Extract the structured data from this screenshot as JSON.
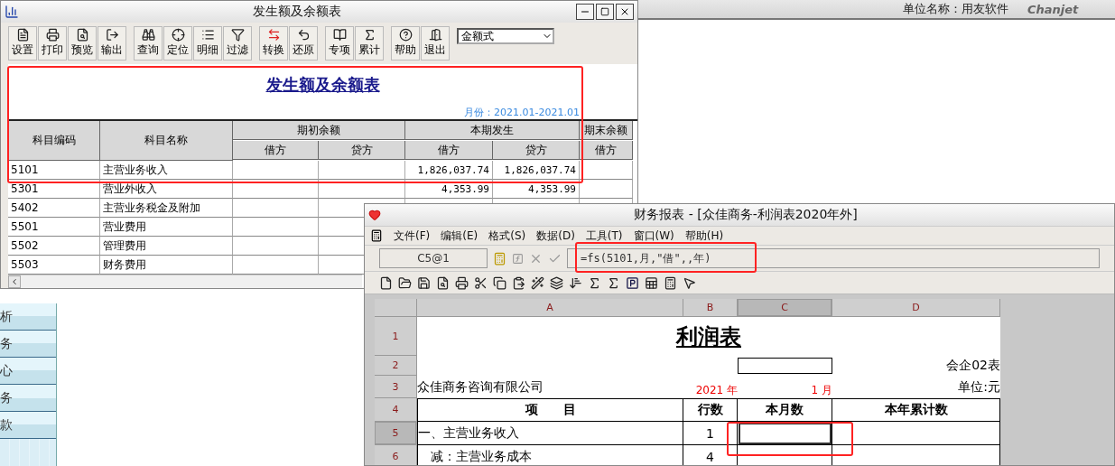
{
  "app_header": {
    "company_label": "单位名称：用友软件",
    "logo_text": "Chanjet"
  },
  "sidebar": {
    "items": [
      {
        "label": "析"
      },
      {
        "label": "务"
      },
      {
        "label": "心"
      },
      {
        "label": "务"
      },
      {
        "label": "款"
      }
    ]
  },
  "balance_window": {
    "title": "发生额及余额表",
    "toolbar": [
      [
        {
          "label": "设置"
        },
        {
          "label": "打印"
        },
        {
          "label": "预览"
        },
        {
          "label": "输出"
        }
      ],
      [
        {
          "label": "查询"
        },
        {
          "label": "定位"
        },
        {
          "label": "明细"
        },
        {
          "label": "过滤"
        }
      ],
      [
        {
          "label": "转换"
        },
        {
          "label": "还原"
        }
      ],
      [
        {
          "label": "专项"
        },
        {
          "label": "累计"
        }
      ],
      [
        {
          "label": "帮助"
        },
        {
          "label": "退出"
        }
      ]
    ],
    "format_select": "金额式",
    "report_title": "发生额及余额表",
    "period": "月份：2021.01-2021.01",
    "table": {
      "header_groups": [
        {
          "label": "科目编码"
        },
        {
          "label": "科目名称"
        },
        {
          "label": "期初余额",
          "sub": [
            "借方",
            "贷方"
          ]
        },
        {
          "label": "本期发生",
          "sub": [
            "借方",
            "贷方"
          ]
        },
        {
          "label": "期末余额",
          "sub": [
            "借方"
          ]
        }
      ],
      "rows": [
        {
          "code": "5101",
          "name": "主营业务收入",
          "period_debit": "1,826,037.74",
          "period_credit": "1,826,037.74"
        },
        {
          "code": "5301",
          "name": "营业外收入",
          "period_debit": "4,353.99",
          "period_credit": "4,353.99"
        },
        {
          "code": "5402",
          "name": "主营业务税金及附加"
        },
        {
          "code": "5501",
          "name": "营业费用"
        },
        {
          "code": "5502",
          "name": "管理费用"
        },
        {
          "code": "5503",
          "name": "财务费用"
        }
      ]
    }
  },
  "report_window": {
    "title": "财务报表 - [众佳商务-利润表2020年外]",
    "menu": [
      "文件(F)",
      "编辑(E)",
      "格式(S)",
      "数据(D)",
      "工具(T)",
      "窗口(W)",
      "帮助(H)"
    ],
    "formula_bar": {
      "cell_ref": "C5@1",
      "formula": "=fs(5101,月,\"借\",,年)"
    },
    "sheet": {
      "columns": [
        {
          "label": "A",
          "selected": false
        },
        {
          "label": "B",
          "selected": false
        },
        {
          "label": "C",
          "selected": true
        },
        {
          "label": "D",
          "selected": false
        }
      ],
      "rows": [
        {
          "label": "1",
          "selected": false
        },
        {
          "label": "2",
          "selected": false
        },
        {
          "label": "3",
          "selected": false
        },
        {
          "label": "4",
          "selected": false
        },
        {
          "label": "5",
          "selected": true
        },
        {
          "label": "6",
          "selected": false
        }
      ],
      "title": "利润表",
      "form_no": "会企02表",
      "company": "众佳商务咨询有限公司",
      "year": "2021 年",
      "month": "1 月",
      "unit": "单位:元",
      "headers": [
        "项　　目",
        "行数",
        "本月数",
        "本年累计数"
      ],
      "body": [
        {
          "kind": "main",
          "item": "一、主营业务收入",
          "line": "1"
        },
        {
          "kind": "deduction",
          "item": "减：主营业务成本",
          "line": "4"
        }
      ]
    }
  }
}
